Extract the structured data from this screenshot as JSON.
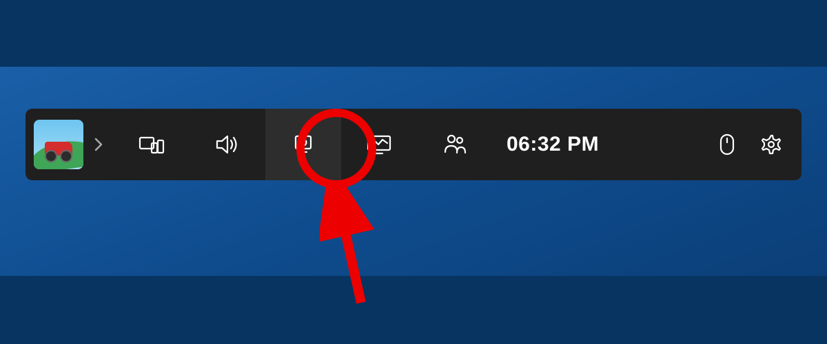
{
  "gamebar": {
    "clock_time": "06:32 PM",
    "app_name": "Hill Climb Racing",
    "icons": {
      "chevron": "chevron-right-icon",
      "widgets": "widgets-icon",
      "audio": "audio-icon",
      "capture": "capture-icon",
      "performance": "performance-icon",
      "xbox_social": "xbox-social-icon",
      "mouse": "mouse-icon",
      "settings": "settings-icon"
    }
  },
  "annotation": {
    "highlight_target": "capture-button",
    "circle_color": "#ed0000",
    "arrow_color": "#ed0000"
  }
}
